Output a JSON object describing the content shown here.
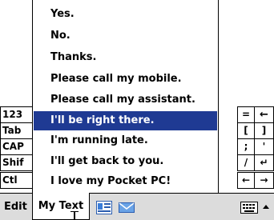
{
  "keyboard": {
    "rows": [
      {
        "left": [
          "123"
        ],
        "right": [
          "=",
          "←"
        ]
      },
      {
        "left": [
          "Tab"
        ],
        "right": [
          "[",
          "]"
        ]
      },
      {
        "left": [
          "CAP"
        ],
        "right": [
          ";",
          "'"
        ]
      },
      {
        "left": [
          "Shif"
        ],
        "right": [
          "/",
          "↵"
        ]
      },
      {
        "left": [
          "Ctl"
        ],
        "right": [
          "←",
          "→"
        ]
      }
    ]
  },
  "menu": {
    "items": [
      "Yes.",
      "No.",
      "Thanks.",
      "Please call my mobile.",
      "Please call my assistant.",
      "I'll be right there.",
      "I'm running late.",
      "I'll get back to you.",
      "I love my Pocket PC!"
    ],
    "selected_index": 5
  },
  "command_bar": {
    "edit_label": "Edit",
    "mytext_label": "My Text",
    "icons": [
      "contact-card-icon",
      "email-icon",
      "keyboard-icon",
      "sip-arrow-icon"
    ]
  },
  "colors": {
    "selection": "#1f3a93",
    "bar": "#dcdcdc"
  }
}
